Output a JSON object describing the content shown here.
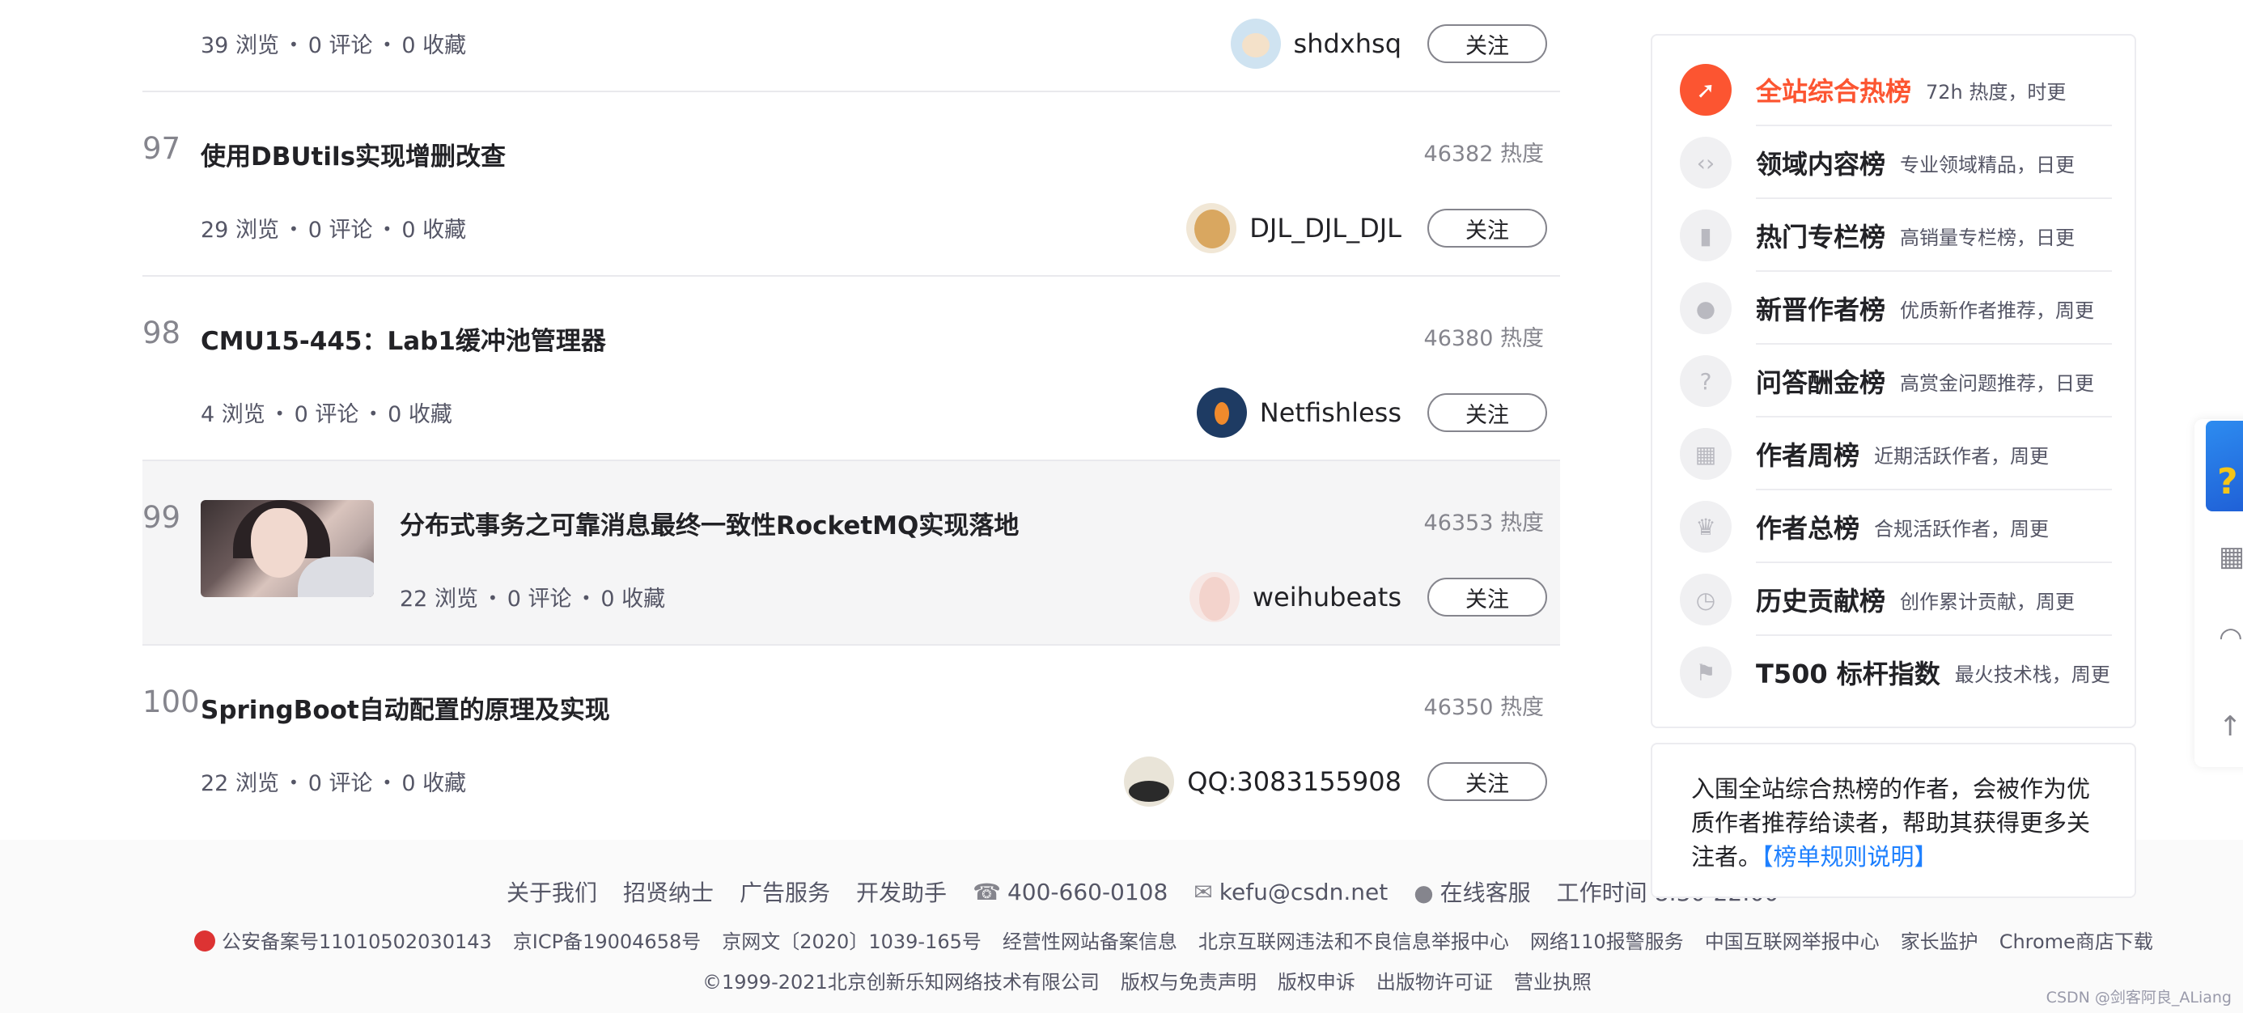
{
  "ranking": [
    {
      "rank": "",
      "title": "",
      "views": "39 浏览",
      "comments": "0 评论",
      "favorites": "0 收藏",
      "heat": "",
      "author": "shdxhsq",
      "avatar_icon": "monkey-avatar-icon",
      "follow_label": "关注"
    },
    {
      "rank": "97",
      "title": "使用DBUtils实现增删改查",
      "views": "29 浏览",
      "comments": "0 评论",
      "favorites": "0 收藏",
      "heat": "46382 热度",
      "author": "DJL_DJL_DJL",
      "avatar_icon": "dog-avatar-icon",
      "follow_label": "关注"
    },
    {
      "rank": "98",
      "title": "CMU15-445：Lab1缓冲池管理器",
      "views": "4 浏览",
      "comments": "0 评论",
      "favorites": "0 收藏",
      "heat": "46380 热度",
      "author": "Netfishless",
      "avatar_icon": "fish-avatar-icon",
      "follow_label": "关注"
    },
    {
      "rank": "99",
      "title": "分布式事务之可靠消息最终一致性RocketMQ实现落地",
      "views": "22 浏览",
      "comments": "0 评论",
      "favorites": "0 收藏",
      "heat": "46353 热度",
      "author": "weihubeats",
      "avatar_icon": "girl-avatar-icon",
      "follow_label": "关注"
    },
    {
      "rank": "100",
      "title": "SpringBoot自动配置的原理及实现",
      "views": "22 浏览",
      "comments": "0 评论",
      "favorites": "0 收藏",
      "heat": "46350 热度",
      "author": "QQ:3083155908",
      "avatar_icon": "qq-avatar-icon",
      "follow_label": "关注"
    }
  ],
  "sidebar": {
    "items": [
      {
        "label": "全站综合热榜",
        "desc": "72h 热度，时更",
        "icon": "rocket-icon"
      },
      {
        "label": "领域内容榜",
        "desc": "专业领域精品，日更",
        "icon": "code-icon"
      },
      {
        "label": "热门专栏榜",
        "desc": "高销量专栏榜，日更",
        "icon": "column-icon"
      },
      {
        "label": "新晋作者榜",
        "desc": "优质新作者推荐，周更",
        "icon": "person-icon"
      },
      {
        "label": "问答酬金榜",
        "desc": "高赏金问题推荐，日更",
        "icon": "question-icon"
      },
      {
        "label": "作者周榜",
        "desc": "近期活跃作者，周更",
        "icon": "calendar-icon"
      },
      {
        "label": "作者总榜",
        "desc": "合规活跃作者，周更",
        "icon": "trophy-icon"
      },
      {
        "label": "历史贡献榜",
        "desc": "创作累计贡献，周更",
        "icon": "clock-icon"
      },
      {
        "label": "T500 标杆指数",
        "desc": "最火技术栈，周更",
        "icon": "benchmark-icon"
      }
    ],
    "note": "入围全站综合热榜的作者，会被作为优质作者推荐给读者，帮助其获得更多关注者。",
    "note_link": "【榜单规则说明】"
  },
  "footer": {
    "links1": [
      "关于我们",
      "招贤纳士",
      "广告服务",
      "开发助手"
    ],
    "phone": "400-660-0108",
    "email": "kefu@csdn.net",
    "service": "在线客服",
    "hours": "工作时间 8:30-22:00",
    "links2": [
      "公安备案号11010502030143",
      "京ICP备19004658号",
      "京网文〔2020〕1039-165号",
      "经营性网站备案信息",
      "北京互联网违法和不良信息举报中心",
      "网络110报警服务",
      "中国互联网举报中心",
      "家长监护",
      "Chrome商店下载"
    ],
    "links3": [
      "©1999-2021北京创新乐知网络技术有限公司",
      "版权与免责声明",
      "版权申诉",
      "出版物许可证",
      "营业执照"
    ]
  },
  "watermark": "CSDN @剑客阿良_ALiang"
}
